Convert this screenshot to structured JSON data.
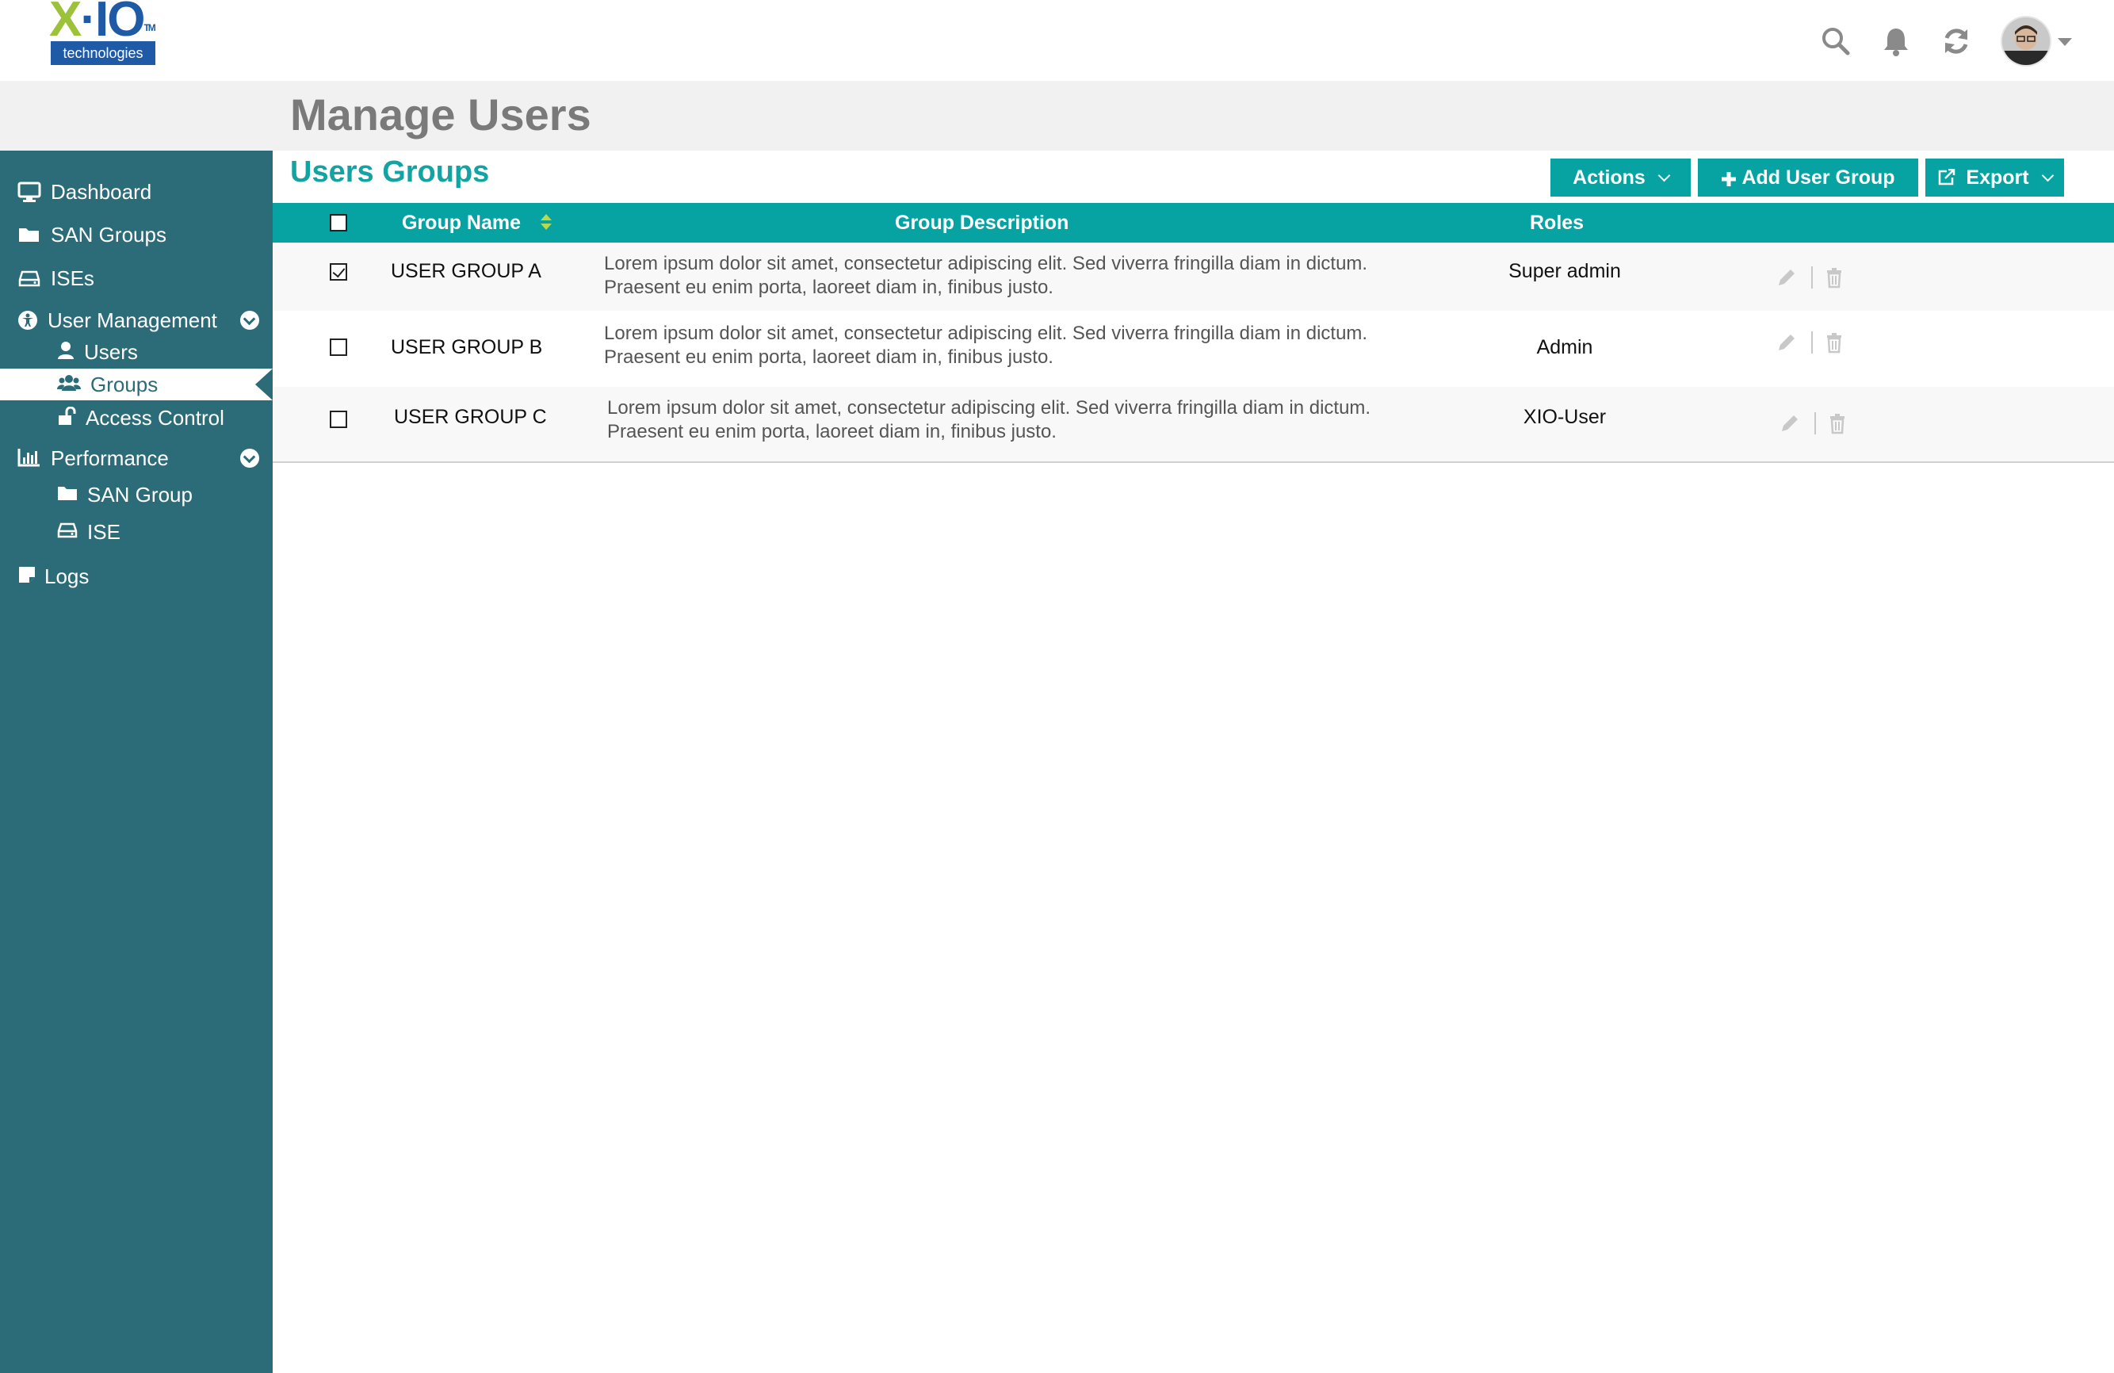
{
  "brand": {
    "logo_mark_x": "X",
    "logo_mark_rest": "·IO",
    "logo_tm": "TM",
    "logo_sub": "technologies"
  },
  "header": {
    "page_title": "Manage Users",
    "icons": [
      "search-icon",
      "bell-icon",
      "refresh-icon",
      "avatar",
      "chevron-down-icon"
    ]
  },
  "sidebar": {
    "items": [
      {
        "label": "Dashboard",
        "icon": "monitor-icon"
      },
      {
        "label": "SAN Groups",
        "icon": "folder-icon"
      },
      {
        "label": "ISEs",
        "icon": "drive-icon"
      },
      {
        "label": "User Management",
        "icon": "accessibility-icon"
      },
      {
        "label": "Users",
        "icon": "user-icon"
      },
      {
        "label": "Groups",
        "icon": "users-icon"
      },
      {
        "label": "Access Control",
        "icon": "unlock-icon"
      },
      {
        "label": "Performance",
        "icon": "bar-chart-icon"
      },
      {
        "label": "SAN Group",
        "icon": "folder-icon"
      },
      {
        "label": "ISE",
        "icon": "drive-icon"
      },
      {
        "label": "Logs",
        "icon": "note-icon"
      }
    ],
    "active": "Groups"
  },
  "section": {
    "title": "Users Groups",
    "actions_label": "Actions",
    "add_label": "Add User Group",
    "add_icon": "plus-icon",
    "export_label": "Export",
    "export_icon": "external-link-icon"
  },
  "table": {
    "headers": {
      "name": "Group Name",
      "description": "Group Description",
      "roles": "Roles"
    },
    "rows": [
      {
        "name": "USER GROUP A",
        "description": "Lorem ipsum dolor sit amet, consectetur adipiscing elit. Sed viverra fringilla diam in dictum. Praesent eu enim porta, laoreet diam in, finibus justo.",
        "role": "Super admin",
        "checked": true
      },
      {
        "name": "USER GROUP B",
        "description": "Lorem ipsum dolor sit amet, consectetur adipiscing elit. Sed viverra fringilla diam in dictum. Praesent eu enim porta, laoreet diam in, finibus justo.",
        "role": "Admin",
        "checked": false
      },
      {
        "name": "USER GROUP C",
        "description": "Lorem ipsum dolor sit amet, consectetur adipiscing elit. Sed viverra fringilla diam in dictum. Praesent eu enim porta, laoreet diam in, finibus justo.",
        "role": "XIO-User",
        "checked": false
      }
    ]
  },
  "colors": {
    "teal": "#07a3a3",
    "sidebar": "#2b6c78",
    "title_gray": "#7a7a7a",
    "logo_blue": "#1f5aa6",
    "logo_green": "#9cc23a"
  }
}
